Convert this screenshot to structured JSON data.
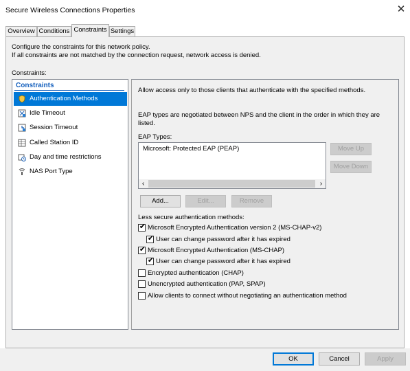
{
  "window": {
    "title": "Secure Wireless Connections Properties",
    "close_glyph": "✕"
  },
  "tabs": [
    {
      "label": "Overview"
    },
    {
      "label": "Conditions"
    },
    {
      "label": "Constraints"
    },
    {
      "label": "Settings"
    }
  ],
  "intro": {
    "line1": "Configure the constraints for this network policy.",
    "line2": "If all constraints are not matched by the connection request, network access is denied."
  },
  "constraints_label": "Constraints:",
  "left_list": {
    "header": "Constraints",
    "items": [
      {
        "label": "Authentication Methods",
        "icon": "key-shield-icon"
      },
      {
        "label": "Idle Timeout",
        "icon": "clock-icon"
      },
      {
        "label": "Session Timeout",
        "icon": "timer-icon"
      },
      {
        "label": "Called Station ID",
        "icon": "table-icon"
      },
      {
        "label": "Day and time restrictions",
        "icon": "calendar-clock-icon"
      },
      {
        "label": "NAS Port Type",
        "icon": "network-port-icon"
      }
    ]
  },
  "right": {
    "allow_text": "Allow access only to those clients that authenticate with the specified methods.",
    "eap_note_line1": "EAP types are negotiated between NPS and the client in the order in which they are",
    "eap_note_line2": "listed.",
    "eap_types_label": "EAP Types:",
    "eap_items": [
      "Microsoft: Protected EAP (PEAP)"
    ],
    "move_up": "Move Up",
    "move_down": "Move Down",
    "add": "Add...",
    "edit": "Edit...",
    "remove": "Remove",
    "less_secure_label": "Less secure authentication methods:",
    "checkboxes": [
      {
        "label": "Microsoft Encrypted Authentication version 2 (MS-CHAP-v2)",
        "checked": true
      },
      {
        "label": "User can change password after it has expired",
        "checked": true
      },
      {
        "label": "Microsoft Encrypted Authentication (MS-CHAP)",
        "checked": true
      },
      {
        "label": "User can change password after it has expired",
        "checked": true
      },
      {
        "label": "Encrypted authentication (CHAP)",
        "checked": false
      },
      {
        "label": "Unencrypted authentication (PAP, SPAP)",
        "checked": false
      },
      {
        "label": "Allow clients to connect without negotiating an authentication method",
        "checked": false
      }
    ]
  },
  "footer": {
    "ok": "OK",
    "cancel": "Cancel",
    "apply": "Apply"
  },
  "colors": {
    "accent": "#0078d7",
    "header_blue": "#1560bd"
  }
}
